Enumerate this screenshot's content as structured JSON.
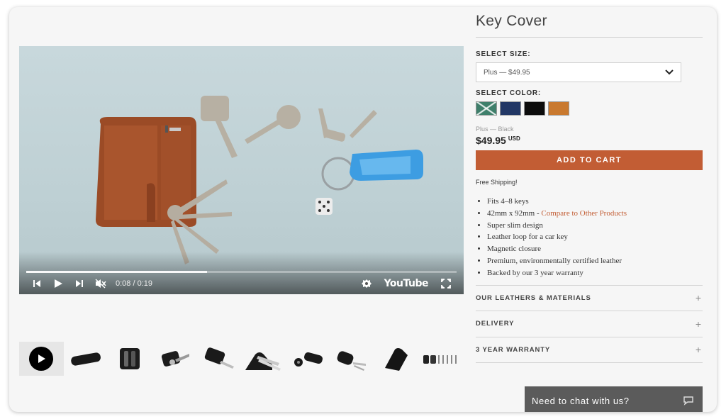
{
  "video": {
    "time_display": "0:08 / 0:19",
    "progress": 0.42,
    "youtube_label": "YouTube"
  },
  "thumbnails": [
    {
      "name": "thumb-video",
      "active": true
    },
    {
      "name": "thumb-1"
    },
    {
      "name": "thumb-2"
    },
    {
      "name": "thumb-3"
    },
    {
      "name": "thumb-4"
    },
    {
      "name": "thumb-5"
    },
    {
      "name": "thumb-6"
    },
    {
      "name": "thumb-7"
    },
    {
      "name": "thumb-8"
    },
    {
      "name": "thumb-9"
    }
  ],
  "product": {
    "title": "Key Cover",
    "size_label": "SELECT SIZE:",
    "size_selected": "Plus — $49.95",
    "color_label": "SELECT COLOR:",
    "colors": [
      "#3f7f6b",
      "#223765",
      "#0c0c0c",
      "#c9792f"
    ],
    "variant_text": "Plus — Black",
    "price": "$49.95",
    "currency": "USD",
    "add_to_cart": "ADD TO CART",
    "shipping": "Free Shipping!",
    "features": [
      "Fits 4–8 keys",
      "42mm x 92mm - ",
      "Super slim design",
      "Leather loop for a car key",
      "Magnetic closure",
      "Premium, environmentally certified leather",
      "Backed by our 3 year warranty"
    ],
    "compare_link": "Compare to Other Products",
    "accent_color": "#c25d34"
  },
  "accordion": [
    {
      "label": "OUR LEATHERS & MATERIALS"
    },
    {
      "label": "DELIVERY"
    },
    {
      "label": "3 YEAR WARRANTY"
    }
  ],
  "chat": {
    "label": "Need to chat with us?"
  }
}
